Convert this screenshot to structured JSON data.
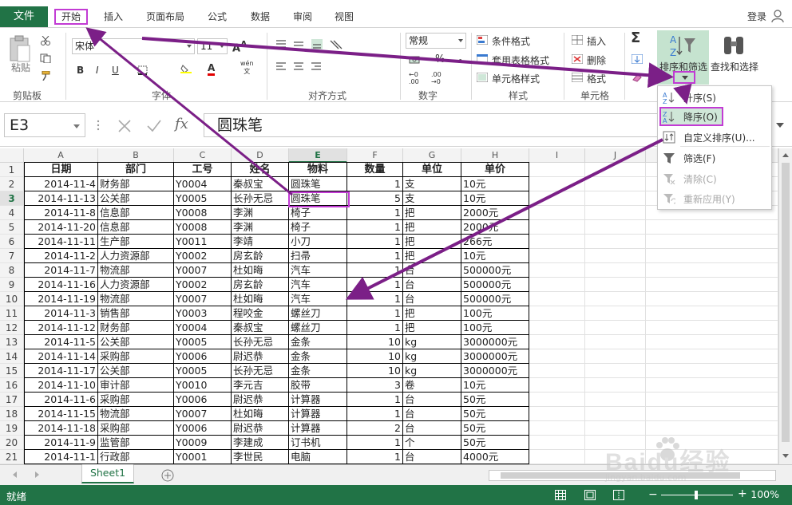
{
  "ribbon_tabs": {
    "file": "文件",
    "home": "开始",
    "insert": "插入",
    "page_layout": "页面布局",
    "formulas": "公式",
    "data": "数据",
    "review": "审阅",
    "view": "视图",
    "login": "登录"
  },
  "ribbon": {
    "clipboard": {
      "paste": "粘贴",
      "label": "剪贴板"
    },
    "font": {
      "name": "宋体",
      "size": "11",
      "label": "字体",
      "wen": "wén\n文"
    },
    "alignment": {
      "label": "对齐方式"
    },
    "number": {
      "format": "常规",
      "label": "数字",
      "percent": "%",
      "comma": ","
    },
    "styles": {
      "conditional": "条件格式",
      "table": "套用表格格式",
      "cell": "单元格样式",
      "label": "样式"
    },
    "cells": {
      "insert": "插入",
      "delete": "删除",
      "format": "格式",
      "label": "单元格"
    },
    "editing": {
      "sort_filter": "排序和筛选",
      "find_select": "查找和选择"
    }
  },
  "formula_bar": {
    "name_box": "E3",
    "fx": "fx",
    "content": "圆珠笔"
  },
  "columns": [
    "A",
    "B",
    "C",
    "D",
    "E",
    "F",
    "G",
    "H",
    "I",
    "J"
  ],
  "selected_column": "E",
  "selected_row": 3,
  "table": {
    "headers": [
      "日期",
      "部门",
      "工号",
      "姓名",
      "物料",
      "数量",
      "单位",
      "单价"
    ],
    "rows": [
      [
        "2014-11-4",
        "财务部",
        "Y0004",
        "秦叔宝",
        "圆珠笔",
        "1",
        "支",
        "10元"
      ],
      [
        "2014-11-13",
        "公关部",
        "Y0005",
        "长孙无忌",
        "圆珠笔",
        "5",
        "支",
        "10元"
      ],
      [
        "2014-11-8",
        "信息部",
        "Y0008",
        "李渊",
        "椅子",
        "1",
        "把",
        "2000元"
      ],
      [
        "2014-11-20",
        "信息部",
        "Y0008",
        "李渊",
        "椅子",
        "1",
        "把",
        "2000元"
      ],
      [
        "2014-11-11",
        "生产部",
        "Y0011",
        "李靖",
        "小刀",
        "1",
        "把",
        "266元"
      ],
      [
        "2014-11-2",
        "人力资源部",
        "Y0002",
        "房玄龄",
        "扫帚",
        "1",
        "把",
        "10元"
      ],
      [
        "2014-11-7",
        "物流部",
        "Y0007",
        "杜如晦",
        "汽车",
        "1",
        "台",
        "500000元"
      ],
      [
        "2014-11-16",
        "人力资源部",
        "Y0002",
        "房玄龄",
        "汽车",
        "1",
        "台",
        "500000元"
      ],
      [
        "2014-11-19",
        "物流部",
        "Y0007",
        "杜如晦",
        "汽车",
        "1",
        "台",
        "500000元"
      ],
      [
        "2014-11-3",
        "销售部",
        "Y0003",
        "程咬金",
        "螺丝刀",
        "1",
        "把",
        "100元"
      ],
      [
        "2014-11-12",
        "财务部",
        "Y0004",
        "秦叔宝",
        "螺丝刀",
        "1",
        "把",
        "100元"
      ],
      [
        "2014-11-5",
        "公关部",
        "Y0005",
        "长孙无忌",
        "金条",
        "10",
        "kg",
        "3000000元"
      ],
      [
        "2014-11-14",
        "采购部",
        "Y0006",
        "尉迟恭",
        "金条",
        "10",
        "kg",
        "3000000元"
      ],
      [
        "2014-11-17",
        "公关部",
        "Y0005",
        "长孙无忌",
        "金条",
        "10",
        "kg",
        "3000000元"
      ],
      [
        "2014-11-10",
        "审计部",
        "Y0010",
        "李元吉",
        "胶带",
        "3",
        "卷",
        "10元"
      ],
      [
        "2014-11-6",
        "采购部",
        "Y0006",
        "尉迟恭",
        "计算器",
        "1",
        "台",
        "50元"
      ],
      [
        "2014-11-15",
        "物流部",
        "Y0007",
        "杜如晦",
        "计算器",
        "1",
        "台",
        "50元"
      ],
      [
        "2014-11-18",
        "采购部",
        "Y0006",
        "尉迟恭",
        "计算器",
        "2",
        "台",
        "50元"
      ],
      [
        "2014-11-9",
        "监管部",
        "Y0009",
        "李建成",
        "订书机",
        "1",
        "个",
        "50元"
      ],
      [
        "2014-11-1",
        "行政部",
        "Y0001",
        "李世民",
        "电脑",
        "1",
        "台",
        "4000元"
      ]
    ]
  },
  "sort_menu": {
    "items": [
      {
        "label": "升序(S)",
        "icon": "sort-ascending-icon",
        "disabled": false
      },
      {
        "label": "降序(O)",
        "icon": "sort-descending-icon",
        "disabled": false
      },
      {
        "label": "自定义排序(U)...",
        "icon": "custom-sort-icon",
        "disabled": false
      },
      {
        "label": "筛选(F)",
        "icon": "filter-icon",
        "disabled": false
      },
      {
        "label": "清除(C)",
        "icon": "clear-filter-icon",
        "disabled": true
      },
      {
        "label": "重新应用(Y)",
        "icon": "reapply-icon",
        "disabled": true
      }
    ]
  },
  "sheet_tabs": [
    "Sheet1"
  ],
  "status": {
    "text": "就绪",
    "zoom": "100%"
  },
  "watermark": {
    "text": "Baidu经验",
    "sub": "jingyan.baidu.com"
  },
  "colors": {
    "excel_green": "#217346",
    "highlight": "#c23bd4",
    "arrow": "#7b1f87"
  }
}
